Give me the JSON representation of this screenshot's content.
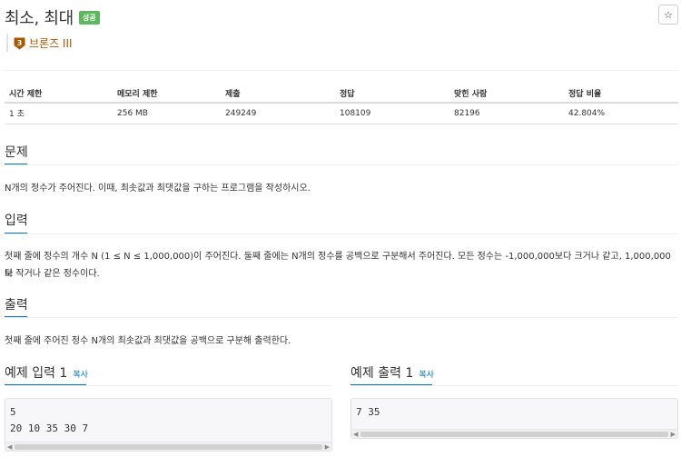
{
  "problem": {
    "title": "최소, 최대",
    "status_badge": "성공",
    "tier": "브론즈 III",
    "tier_number": "3",
    "star": "☆"
  },
  "info_table": {
    "headers": [
      "시간 제한",
      "메모리 제한",
      "제출",
      "정답",
      "맞힌 사람",
      "정답 비율"
    ],
    "values": [
      "1 초",
      "256 MB",
      "249249",
      "108109",
      "82196",
      "42.804%"
    ]
  },
  "sections": {
    "problem": {
      "title": "문제",
      "text": "N개의 정수가 주어진다. 이때, 최솟값과 최댓값을 구하는 프로그램을 작성하시오."
    },
    "input": {
      "title": "입력",
      "line1": "첫째 줄에 정수의 개수 N (1 ≤ N ≤ 1,000,000)이 주어진다. 둘째 줄에는 N개의 정수를 공백으로 구분해서 주어진다. 모든 정수는 -1,000,000보다 크거나 같고, 1,000,000보",
      "line2": "다 작거나 같은 정수이다."
    },
    "output": {
      "title": "출력",
      "text": "첫째 줄에 주어진 정수 N개의 최솟값과 최댓값을 공백으로 구분해 출력한다."
    }
  },
  "samples": {
    "input": {
      "title": "예제 입력 1",
      "copy": "복사",
      "lines": [
        "5",
        "20 10 35 30 7"
      ]
    },
    "output": {
      "title": "예제 출력 1",
      "copy": "복사",
      "lines": [
        "7 35"
      ]
    }
  },
  "colors": {
    "badge": "#5cb85c",
    "tier": "#ad5600",
    "accent": "#0076c0"
  }
}
